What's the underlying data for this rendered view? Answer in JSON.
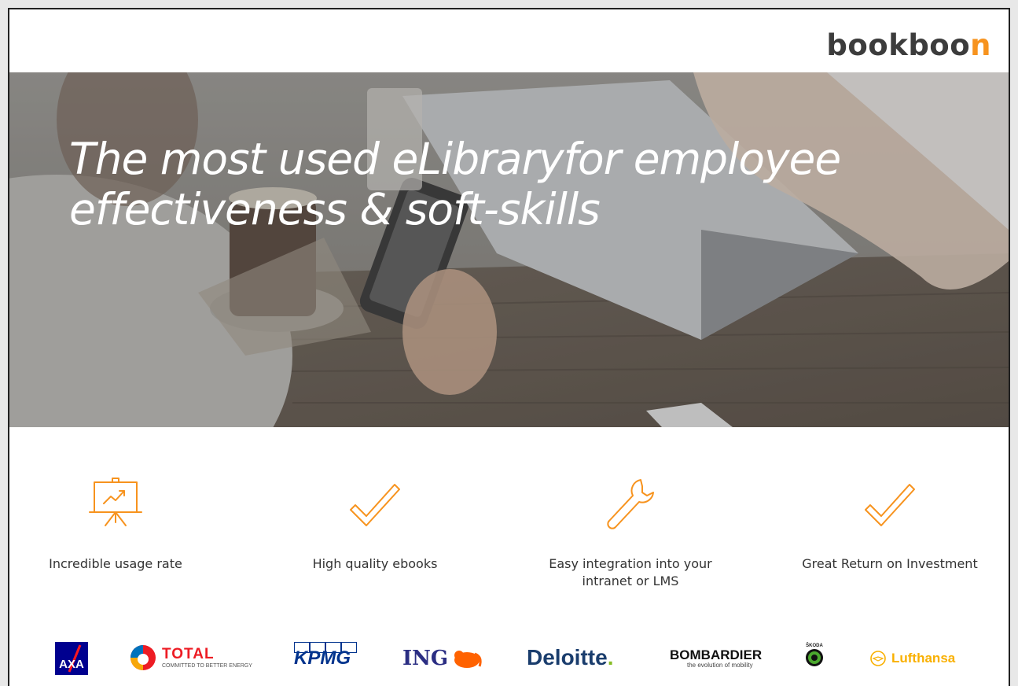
{
  "brand": {
    "text_main": "bookboo",
    "text_accent": "n"
  },
  "hero": {
    "headline": "The most used eLibraryfor employee effectiveness & soft-skills"
  },
  "features": [
    {
      "label": "Incredible usage rate",
      "icon": "presentation-chart-icon"
    },
    {
      "label": "High quality ebooks",
      "icon": "checkmark-icon"
    },
    {
      "label": "Easy integration into your intranet or LMS",
      "icon": "wrench-icon"
    },
    {
      "label": "Great Return on Investment",
      "icon": "checkmark-icon"
    }
  ],
  "clients": {
    "axa": "AXA",
    "total": "TOTAL",
    "total_tagline": "COMMITTED TO BETTER ENERGY",
    "kpmg": "KPMG",
    "ing": "ING",
    "deloitte": "Deloitte",
    "bombardier": "BOMBARDIER",
    "bombardier_tagline": "the evolution of mobility",
    "skoda": "ŠKODA",
    "lufthansa": "Lufthansa"
  },
  "colors": {
    "accent": "#f7931e",
    "text": "#333333",
    "deloitte_green": "#86bc25",
    "kpmg_blue": "#00338d",
    "axa_blue": "#00008f"
  }
}
